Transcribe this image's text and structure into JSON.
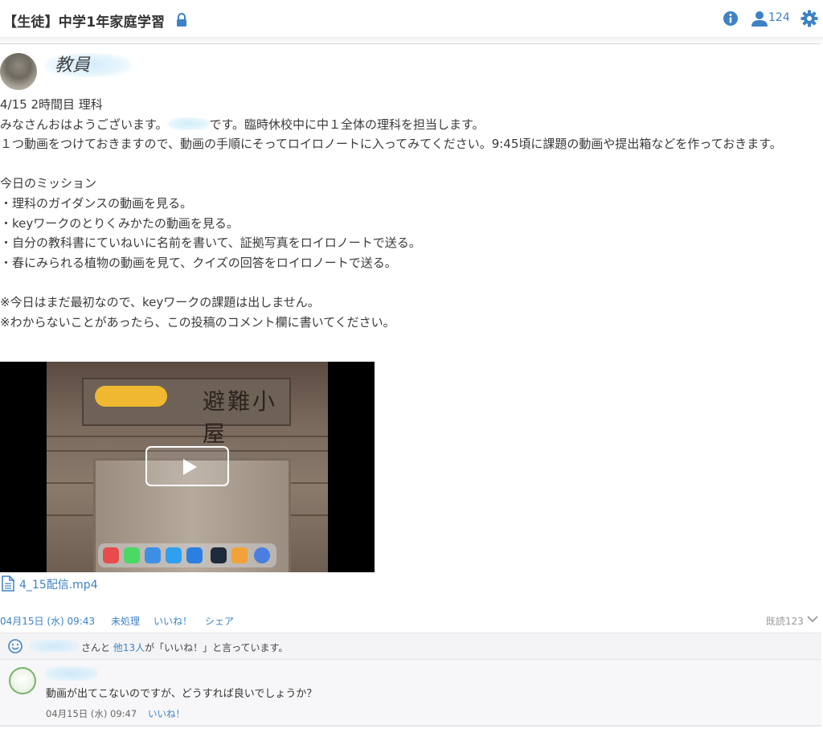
{
  "header": {
    "title": "【生徒】中学1年家庭学習",
    "member_count": "124"
  },
  "post": {
    "author": "教員",
    "lines": {
      "l1": "4/15 2時間目 理科",
      "l2a": "みなさんおはようございます。",
      "l2b": "です。臨時休校中に中１全体の理科を担当します。",
      "l3": "１つ動画をつけておきますので、動画の手順にそってロイロノートに入ってみてください。9:45頃に課題の動画や提出箱などを作っておきます。",
      "l4": "",
      "l5": "今日のミッション",
      "l6": "・理科のガイダンスの動画を見る。",
      "l7": "・keyワークのとりくみかたの動画を見る。",
      "l8": "・自分の教科書にていねいに名前を書いて、証拠写真をロイロノートで送る。",
      "l9": "・春にみられる植物の動画を見て、クイズの回答をロイロノートで送る。",
      "l10": "",
      "l11": "※今日はまだ最初なので、keyワークの課題は出しません。",
      "l12": "※わからないことがあったら、この投稿のコメント欄に書いてください。"
    },
    "video": {
      "sign_text": "避難小屋"
    },
    "attachment": "4_15配信.mp4",
    "meta": {
      "date": "04月15日 (水) 09:43",
      "status": "未処理",
      "like": "いいね！",
      "share": "シェア",
      "read": "既読123"
    },
    "likes": {
      "suffix": "さんと",
      "others": "他13人",
      "tail": "が「いいね！」と言っています。"
    }
  },
  "comment": {
    "text": "動画が出てこないのですが、どうすれば良いでしょうか？",
    "date": "04月15日 (水) 09:47",
    "like": "いいね！"
  },
  "colors": {
    "accent": "#3d82c4",
    "text": "#333333"
  }
}
